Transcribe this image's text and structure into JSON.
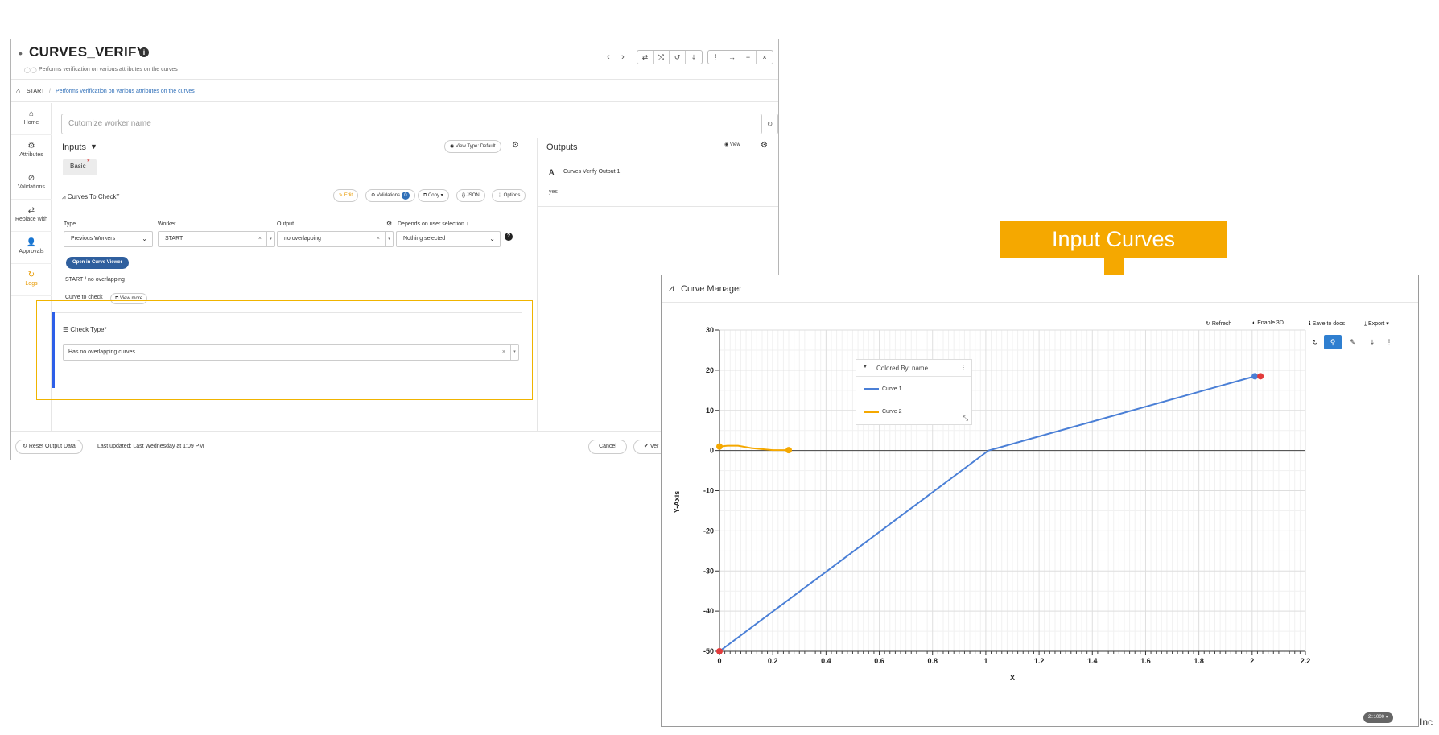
{
  "worker": {
    "title": "CURVES_VERIFY",
    "description": "Performs verification on various attributes on the curves",
    "breadcrumb": {
      "root": "START",
      "current": "Performs verification on various attributes on the curves"
    },
    "nav_prev": "‹",
    "nav_next": "›",
    "name_placeholder": "Cutomize worker name",
    "sidebar": [
      {
        "label": "Home",
        "icon": "home-icon",
        "glyph": "⌂"
      },
      {
        "label": "Attributes",
        "icon": "gear-icon",
        "glyph": "⚙"
      },
      {
        "label": "Validations",
        "icon": "validation-icon",
        "glyph": "⊘"
      },
      {
        "label": "Replace with",
        "icon": "swap-icon",
        "glyph": "⇄"
      },
      {
        "label": "Approvals",
        "icon": "approval-user-icon",
        "glyph": "👤"
      },
      {
        "label": "Logs",
        "icon": "logs-icon",
        "glyph": "↻"
      }
    ],
    "inputs": {
      "heading": "Inputs",
      "view_type": "View Type: Default",
      "tab": "Basic",
      "curves_label": "Curves To Check",
      "buttons": {
        "edit": "Edit",
        "validations": "Validations",
        "validations_count": "0",
        "copy": "Copy ▾",
        "json": "{} JSON",
        "options": "⋮ Options"
      },
      "columns": {
        "type": "Type",
        "worker": "Worker",
        "output": "Output",
        "depends": "Depends on user selection ↓"
      },
      "values": {
        "type": "Previous Workers",
        "worker": "START",
        "output": "no overlapping",
        "depends": "Nothing selected"
      },
      "open_viewer": "Open in Curve Viewer",
      "path": "START / no overlapping",
      "curve_to_check": "Curve to check",
      "view_more": "View more",
      "check_type_label": "Check Type",
      "check_type_value": "Has no overlapping curves"
    },
    "outputs": {
      "heading": "Outputs",
      "view": "View",
      "item_name": "Curves Verify Output 1",
      "item_value": "yes"
    },
    "footer": {
      "reset": "Reset Output Data",
      "last_updated": "Last updated: Last Wednesday at 1:09 PM",
      "cancel": "Cancel",
      "verify": "Ver"
    }
  },
  "callout": {
    "text": "Input Curves",
    "color": "#f5a800"
  },
  "curve_manager": {
    "title": "Curve Manager",
    "toolbar": {
      "refresh": "Refresh",
      "enable3d": "Enable 3D",
      "save": "Save to docs",
      "export": "Export ▾"
    },
    "legend_title": "Colored By: name",
    "badge": "2::1000"
  },
  "chart_data": {
    "type": "line",
    "xlabel": "X",
    "ylabel": "Y-Axis",
    "xlim": [
      0,
      2.2
    ],
    "ylim": [
      -50,
      30
    ],
    "xticks": [
      0,
      0.2,
      0.4,
      0.6,
      0.8,
      1,
      1.2,
      1.4,
      1.6,
      1.8,
      2,
      2.2
    ],
    "yticks": [
      -50,
      -40,
      -30,
      -20,
      -10,
      0,
      10,
      20,
      30
    ],
    "grid": true,
    "legend_position": "top-left",
    "series": [
      {
        "name": "Curve 1",
        "color": "#4a7fd6",
        "x": [
          0,
          1.01,
          2.01
        ],
        "y": [
          -50,
          0,
          18.5
        ]
      },
      {
        "name": "Curve 2",
        "color": "#f5a800",
        "x": [
          0,
          0.03,
          0.07,
          0.12,
          0.2,
          0.26
        ],
        "y": [
          1.0,
          1.2,
          1.2,
          0.6,
          0.1,
          0.1
        ]
      }
    ],
    "start_marker_color": "#e23b3b",
    "end_marker_color": "#e23b3b"
  },
  "footnote": "Inc"
}
